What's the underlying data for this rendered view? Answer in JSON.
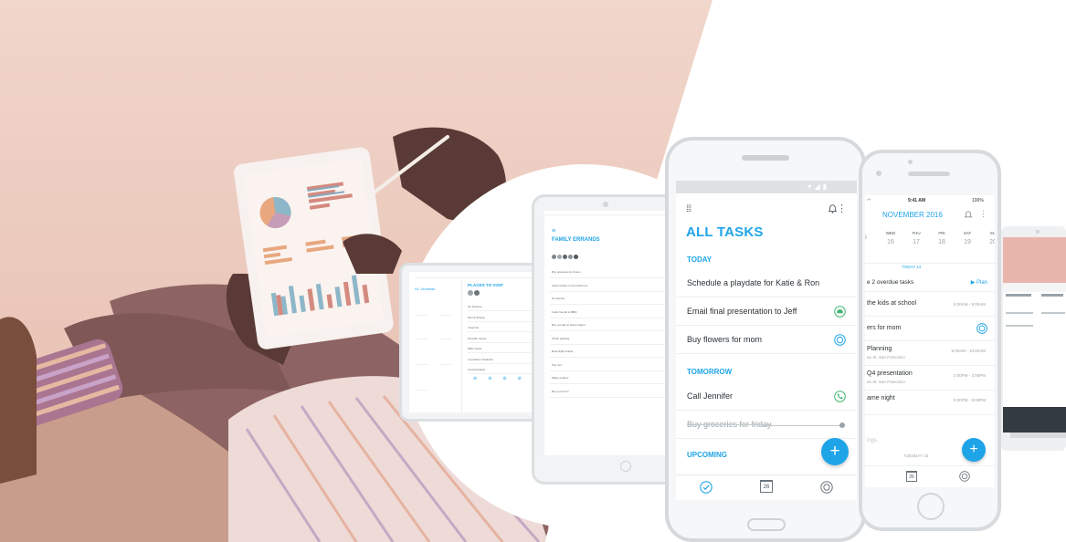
{
  "main_phone": {
    "header_title": "ALL TASKS",
    "section_today": "TODAY",
    "section_tomorrow": "TOMORROW",
    "section_upcoming": "UPCOMING",
    "tasks_today": [
      {
        "text": "Schedule a playdate for Katie & Ron",
        "icon": ""
      },
      {
        "text": "Email final presentation to Jeff",
        "icon": "car-icon"
      },
      {
        "text": "Buy flowers for mom",
        "icon": "location-icon"
      }
    ],
    "tasks_tomorrow": [
      {
        "text": "Call Jennifer",
        "icon": "phone-icon"
      },
      {
        "text": "Buy groceries for friday",
        "icon": "completed-dot-icon"
      }
    ],
    "fab_label": "+",
    "tabbar": {
      "tasks_icon": "check-circle-icon",
      "calendar_day": "26",
      "location_icon": "target-icon"
    },
    "colors": {
      "accent": "#1fa4e8",
      "green": "#3db36b"
    }
  },
  "right_phone": {
    "status_time": "9:41 AM",
    "status_battery": "100%",
    "month_title": "NOVEMBER 2016",
    "weekdays": [
      "",
      "WED",
      "THU",
      "FRI",
      "SAT",
      "SU"
    ],
    "dates": [
      "5",
      "16",
      "17",
      "18",
      "19",
      "20"
    ],
    "today_label": "TODAY 14",
    "overdue_text": "e 2 overdue tasks",
    "plan_label": "▶ Plan",
    "rows": [
      {
        "title": "the kids at school",
        "sub": "",
        "time": "8:00AM - 9:00AM"
      },
      {
        "title": "ers for mom",
        "sub": "",
        "time": ""
      },
      {
        "title": "Planning",
        "sub": "an St, San Francisco",
        "time": "9:00AM - 10:00AM"
      },
      {
        "title": "Q4 presentation",
        "sub": "an St, San Francisco",
        "time": "2:00PM - 3:00PM"
      },
      {
        "title": "ame night",
        "sub": "",
        "time": "8:00PM - 9:00PM"
      }
    ],
    "bottom_faded": "ings",
    "tuesday_label": "TUESDAY 15",
    "fab_label": "+",
    "calendar_day": "26"
  },
  "middle_tablet": {
    "list_title": "FAMILY ERRANDS",
    "items": [
      "Buy groceries for dinner",
      "Clean bottles in the bathroom",
      "Do laundry",
      "Invite friends to BBQ",
      "Buy cereals at Home Depot",
      "Finish painting",
      "Book flight tickets",
      "Pay rent",
      "Make cookies",
      "Buy a new TV"
    ]
  },
  "left_tablet": {
    "greeting_small": "Hi, Jonathan",
    "list_title": "PLACES TO VISIT",
    "items": [
      "SF, Dolores",
      "Mount Shasta",
      "Yosemite",
      "Presidio Center",
      "Eiffel Tower",
      "Lost Alamo Tarplants",
      "Cal landmarks"
    ]
  }
}
